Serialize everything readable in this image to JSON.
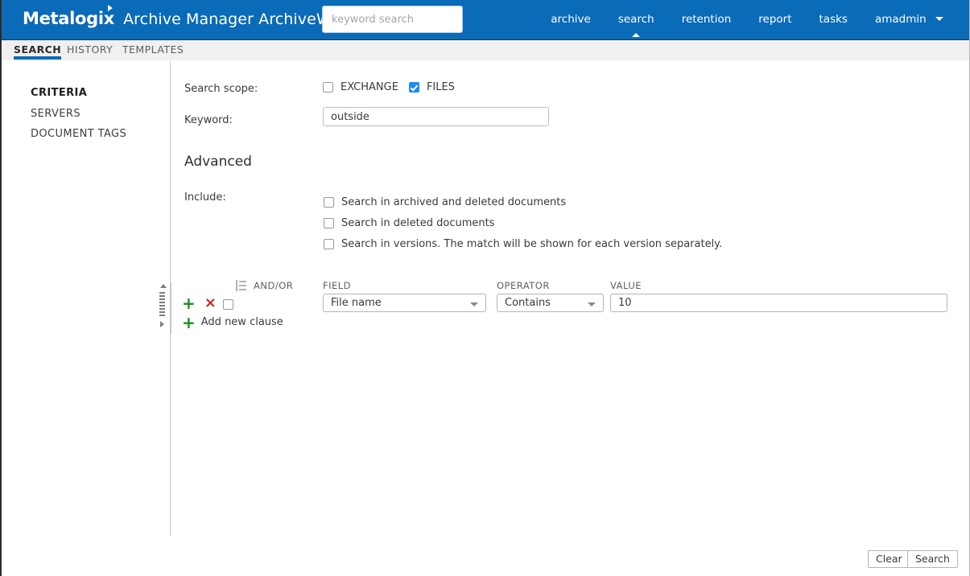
{
  "header": {
    "brand": "Metalogix",
    "product": "Archive Manager ArchiveWeb",
    "search_placeholder": "keyword search",
    "search_value": "",
    "accent_color": "#0a6bb8",
    "nav": [
      {
        "label": "archive",
        "active": false
      },
      {
        "label": "search",
        "active": true
      },
      {
        "label": "retention",
        "active": false
      },
      {
        "label": "report",
        "active": false
      },
      {
        "label": "tasks",
        "active": false
      },
      {
        "label": "amadmin",
        "active": false,
        "has_caret": true
      }
    ]
  },
  "sub_tabs": [
    {
      "label": "SEARCH",
      "active": true
    },
    {
      "label": "HISTORY",
      "active": false
    },
    {
      "label": "TEMPLATES",
      "active": false
    }
  ],
  "sidebar": {
    "items": [
      {
        "label": "CRITERIA",
        "active": true
      },
      {
        "label": "SERVERS",
        "active": false
      },
      {
        "label": "DOCUMENT TAGS",
        "active": false
      }
    ]
  },
  "main": {
    "search_scope_label": "Search scope:",
    "scope_options": [
      {
        "label": "EXCHANGE",
        "checked": false
      },
      {
        "label": "FILES",
        "checked": true
      }
    ],
    "keyword_label": "Keyword:",
    "keyword_value": "outside",
    "keyword_placeholder": "",
    "advanced_heading": "Advanced",
    "include_label": "Include:",
    "include_options": [
      {
        "label": "Search in archived and deleted documents",
        "checked": false
      },
      {
        "label": "Search in deleted documents",
        "checked": false
      },
      {
        "label": "Search in versions. The match will be shown for each version separately.",
        "checked": false
      }
    ],
    "clause_builder": {
      "columns": {
        "andor": "AND/OR",
        "field": "FIELD",
        "operator": "OPERATOR",
        "value": "VALUE"
      },
      "add_clause_label": "Add new clause",
      "add_icon": "+",
      "remove_icon": "×",
      "rows": [
        {
          "andor_checked": false,
          "field": "File name",
          "operator": "Contains",
          "value": "10"
        }
      ]
    }
  },
  "footer": {
    "clear_label": "Clear",
    "search_label": "Search"
  },
  "colors": {
    "header_blue": "#0a6bb8",
    "checkbox_blue": "#1a8cf5",
    "plus_green": "#1f8b1f",
    "remove_red": "#cc2222",
    "tabbar_grey": "#f0f0f0"
  }
}
